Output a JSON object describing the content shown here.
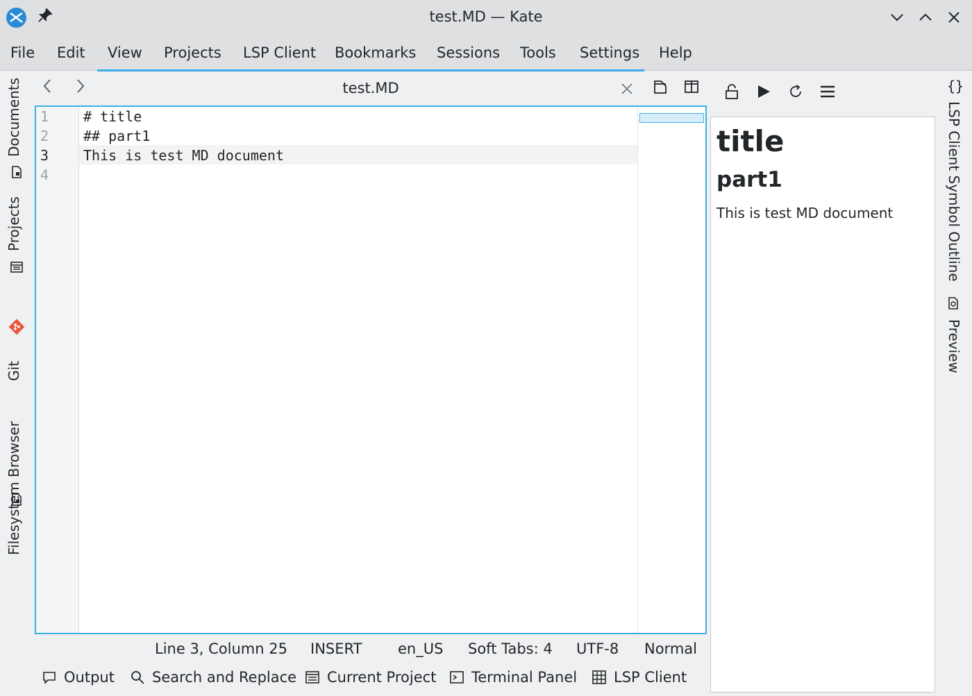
{
  "window": {
    "title": "test.MD — Kate"
  },
  "menubar": {
    "items": [
      "File",
      "Edit",
      "View",
      "Projects",
      "LSP Client",
      "Bookmarks",
      "Sessions",
      "Tools",
      "Settings",
      "Help"
    ]
  },
  "left_sidebar": {
    "tabs": [
      "Documents",
      "Projects",
      "Git",
      "Filesystem Browser"
    ]
  },
  "right_sidebar": {
    "tabs": [
      "LSP Client Symbol Outline",
      "Preview"
    ]
  },
  "tabs": {
    "active": "test.MD"
  },
  "editor": {
    "line_numbers": [
      "1",
      "2",
      "3",
      "4"
    ],
    "lines": [
      "# title",
      "## part1",
      "This is test MD document",
      ""
    ]
  },
  "preview": {
    "h1": "title",
    "h2": "part1",
    "paragraph": "This is test MD document"
  },
  "statusbar": {
    "position": "Line 3, Column 25",
    "mode": "INSERT",
    "language": "en_US",
    "indent": "Soft Tabs: 4",
    "encoding": "UTF-8",
    "highlight": "Normal"
  },
  "bottom_panels": [
    "Output",
    "Search and Replace",
    "Current Project",
    "Terminal Panel",
    "LSP Client"
  ],
  "colors": {
    "accent": "#3daee9",
    "git": "#e8553a"
  }
}
